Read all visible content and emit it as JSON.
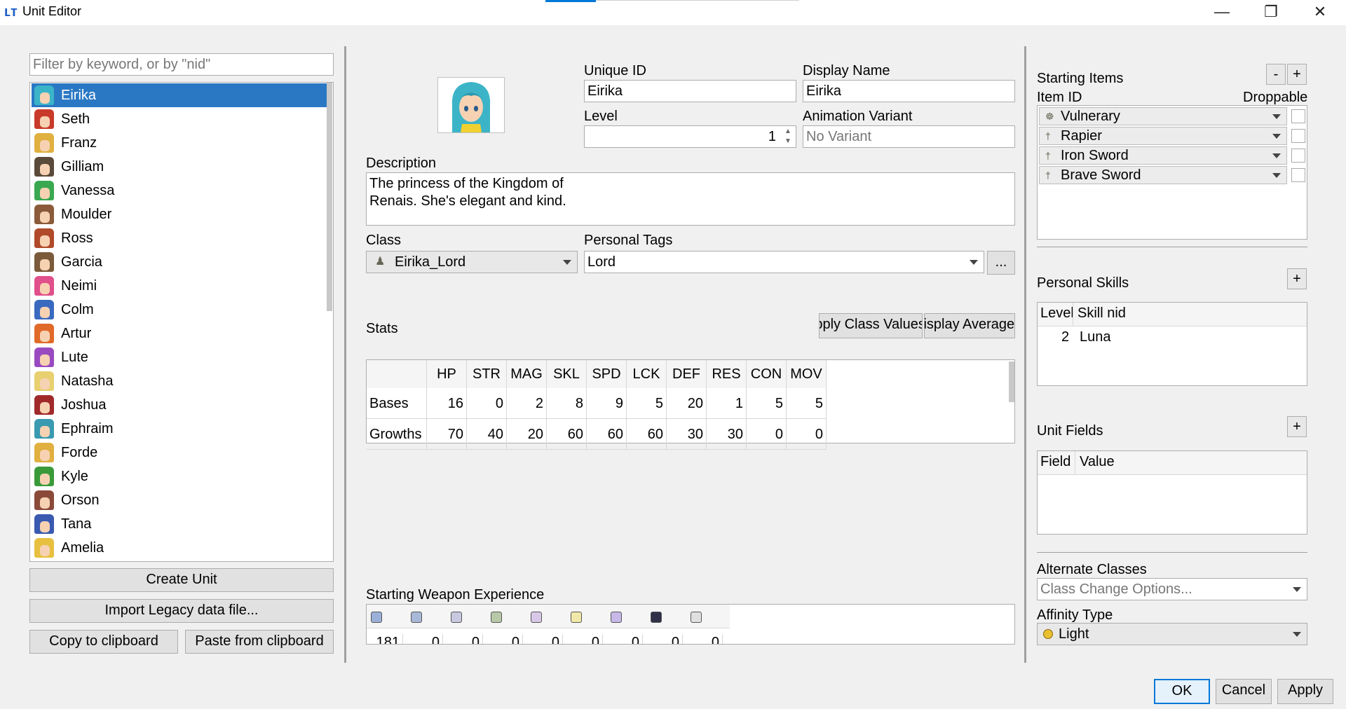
{
  "window": {
    "title": "Unit Editor",
    "app_icon": "lt-logo-icon",
    "controls": [
      "—",
      "❐",
      "✕"
    ]
  },
  "unit_list": {
    "filter_placeholder": "Filter by keyword, or by \"nid\"",
    "units": [
      {
        "name": "Eirika",
        "hair": "#3cb4c8",
        "selected": true
      },
      {
        "name": "Seth",
        "hair": "#c83a2a"
      },
      {
        "name": "Franz",
        "hair": "#e0b040"
      },
      {
        "name": "Gilliam",
        "hair": "#5a4a3a"
      },
      {
        "name": "Vanessa",
        "hair": "#3aa850"
      },
      {
        "name": "Moulder",
        "hair": "#8a5a3a"
      },
      {
        "name": "Ross",
        "hair": "#b04a2a"
      },
      {
        "name": "Garcia",
        "hair": "#7a5a3a"
      },
      {
        "name": "Neimi",
        "hair": "#e0508a"
      },
      {
        "name": "Colm",
        "hair": "#3a6ac0"
      },
      {
        "name": "Artur",
        "hair": "#e06a2a"
      },
      {
        "name": "Lute",
        "hair": "#9a4ac0"
      },
      {
        "name": "Natasha",
        "hair": "#e8d070"
      },
      {
        "name": "Joshua",
        "hair": "#a02a2a"
      },
      {
        "name": "Ephraim",
        "hair": "#3a9ab0"
      },
      {
        "name": "Forde",
        "hair": "#e0b040"
      },
      {
        "name": "Kyle",
        "hair": "#3a9a3a"
      },
      {
        "name": "Orson",
        "hair": "#8a4a3a"
      },
      {
        "name": "Tana",
        "hair": "#3a5ab0"
      },
      {
        "name": "Amelia",
        "hair": "#e8c040"
      }
    ],
    "create_button": "Create Unit",
    "import_button": "Import Legacy data file...",
    "copy_button": "Copy to clipboard",
    "paste_button": "Paste from clipboard"
  },
  "details": {
    "unique_id_label": "Unique ID",
    "unique_id": "Eirika",
    "display_name_label": "Display Name",
    "display_name": "Eirika",
    "level_label": "Level",
    "level": "1",
    "animation_variant_label": "Animation Variant",
    "animation_variant_placeholder": "No Variant",
    "description_label": "Description",
    "description_line1": "The princess of the Kingdom of",
    "description_line2": "Renais. She's elegant and kind.",
    "class_label": "Class",
    "class_value": "Eirika_Lord",
    "personal_tags_label": "Personal Tags",
    "personal_tags_value": "Lord",
    "tags_more_button": "...",
    "stats_label": "Stats",
    "apply_class_values_button": "Apply Class Values",
    "display_averages_button": "Display Averages",
    "starting_wexp_label": "Starting Weapon Experience",
    "wexp_first_value": "181",
    "wexp_values": [
      "0",
      "0",
      "0",
      "0",
      "0",
      "0",
      "0",
      "0"
    ]
  },
  "stats": {
    "columns": [
      "HP",
      "STR",
      "MAG",
      "SKL",
      "SPD",
      "LCK",
      "DEF",
      "RES",
      "CON",
      "MOV"
    ],
    "rows": [
      {
        "label": "Bases",
        "values": [
          "16",
          "0",
          "2",
          "8",
          "9",
          "5",
          "20",
          "1",
          "5",
          "5"
        ]
      },
      {
        "label": "Growths",
        "values": [
          "70",
          "40",
          "20",
          "60",
          "60",
          "60",
          "30",
          "30",
          "0",
          "0"
        ]
      }
    ]
  },
  "right_panel": {
    "starting_items_label": "Starting Items",
    "remove_button": "-",
    "add_button": "+",
    "item_id_header": "Item ID",
    "droppable_header": "Droppable",
    "items": [
      {
        "name": "Vulnerary",
        "icon": "☸"
      },
      {
        "name": "Rapier",
        "icon": "†"
      },
      {
        "name": "Iron Sword",
        "icon": "†"
      },
      {
        "name": "Brave Sword",
        "icon": "†"
      }
    ],
    "personal_skills_label": "Personal Skills",
    "skills_add_button": "+",
    "skill_level_header": "Level",
    "skill_nid_header": "Skill nid",
    "skill_level": "2",
    "skill_nid": "Luna",
    "unit_fields_label": "Unit Fields",
    "fields_add_button": "+",
    "field_header": "Field",
    "value_header": "Value",
    "alternate_classes_label": "Alternate Classes",
    "alternate_classes_placeholder": "Class Change Options...",
    "affinity_label": "Affinity Type",
    "affinity_value": "Light"
  },
  "dialog_buttons": {
    "ok": "OK",
    "cancel": "Cancel",
    "apply": "Apply"
  },
  "colors": {
    "selection": "#2a78c4",
    "window_bg": "#f0f0f0",
    "accent": "#0078d7"
  }
}
